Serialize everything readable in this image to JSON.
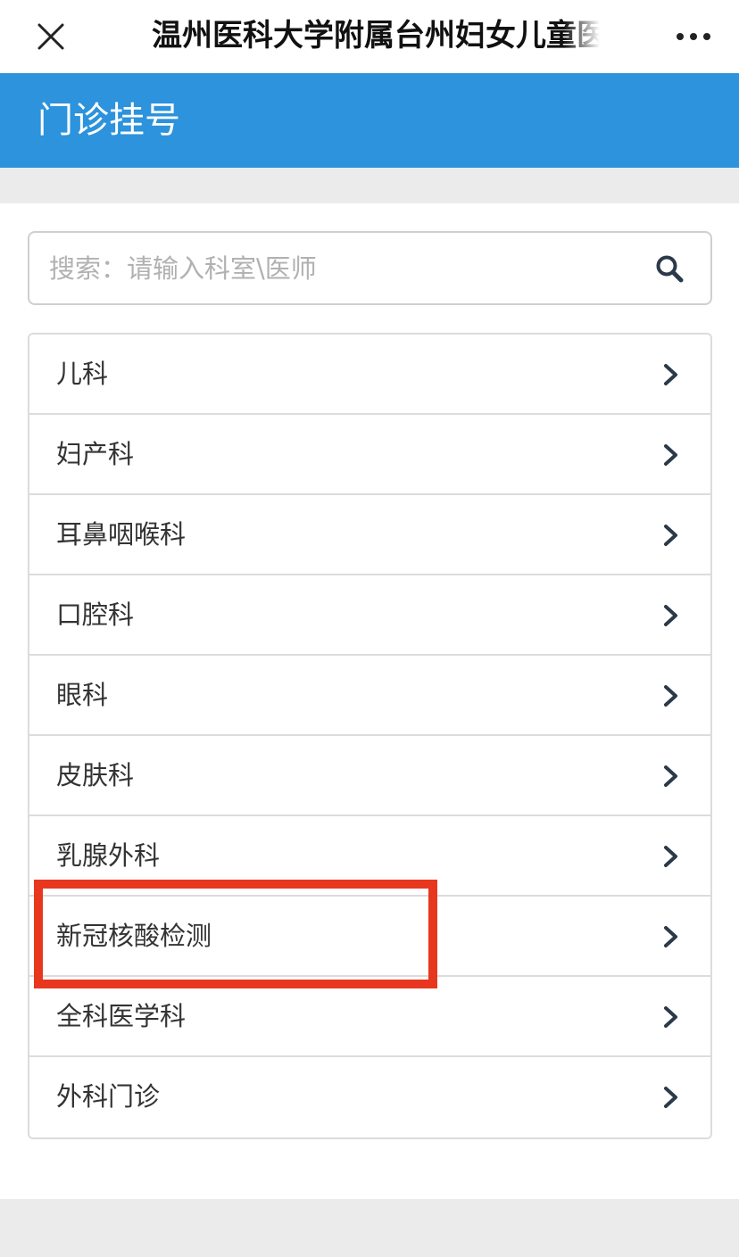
{
  "window": {
    "title": "温州医科大学附属台州妇女儿童医院"
  },
  "header": {
    "title": "门诊挂号",
    "background_color": "#2c93dc"
  },
  "search": {
    "placeholder": "搜索：请输入科室\\医师",
    "value": "",
    "icon": "search-icon"
  },
  "departments": [
    {
      "label": "儿科"
    },
    {
      "label": "妇产科"
    },
    {
      "label": "耳鼻咽喉科"
    },
    {
      "label": "口腔科"
    },
    {
      "label": "眼科"
    },
    {
      "label": "皮肤科"
    },
    {
      "label": "乳腺外科"
    },
    {
      "label": "新冠核酸检测"
    },
    {
      "label": "全科医学科"
    },
    {
      "label": "外科门诊"
    }
  ],
  "icons": {
    "close": "close-icon",
    "more": "more-icon",
    "row_arrow": "chevron-right-icon"
  },
  "colors": {
    "accent": "#2c93dc",
    "highlight": "#e8371f",
    "separator": "#dcdcdc"
  }
}
